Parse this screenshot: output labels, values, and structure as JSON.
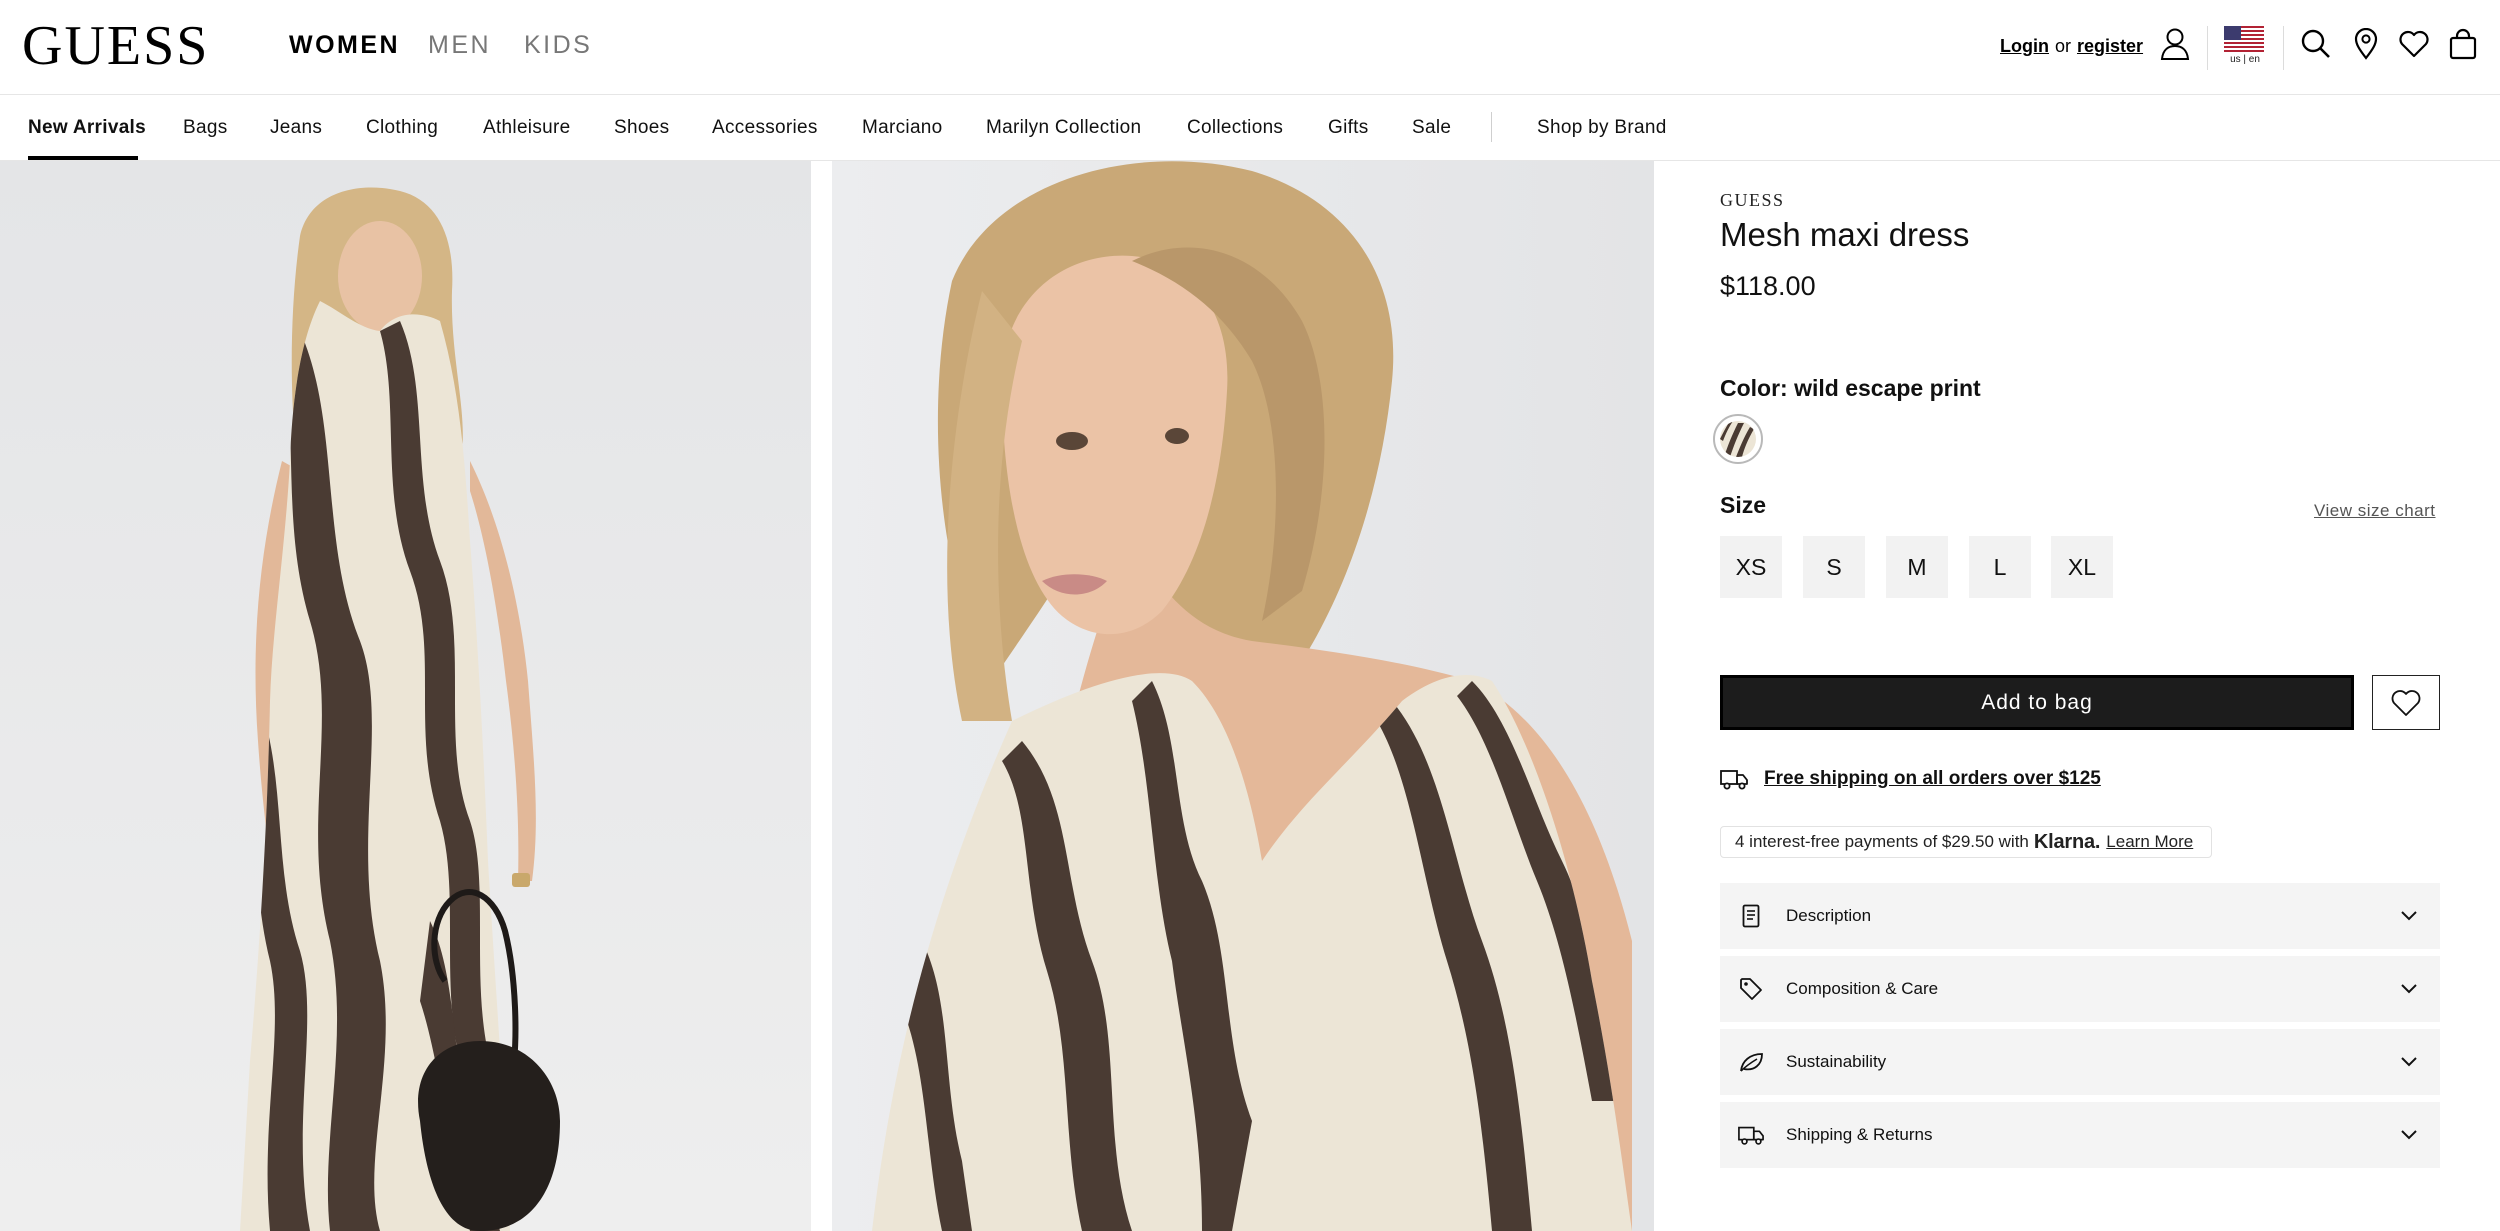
{
  "header": {
    "logo": "GUESS",
    "gender_tabs": [
      {
        "label": "WOMEN",
        "active": true
      },
      {
        "label": "MEN",
        "active": false
      },
      {
        "label": "KIDS",
        "active": false
      }
    ],
    "login_label": "Login",
    "or_label": "or",
    "register_label": "register",
    "locale_label": "us | en",
    "icons": [
      "account-icon",
      "us-flag-icon",
      "search-icon",
      "store-locator-icon",
      "wishlist-icon",
      "shopping-bag-icon"
    ]
  },
  "category_nav": {
    "items": [
      {
        "label": "New Arrivals",
        "active": true
      },
      {
        "label": "Bags"
      },
      {
        "label": "Jeans"
      },
      {
        "label": "Clothing"
      },
      {
        "label": "Athleisure"
      },
      {
        "label": "Shoes"
      },
      {
        "label": "Accessories"
      },
      {
        "label": "Marciano"
      },
      {
        "label": "Marilyn Collection"
      },
      {
        "label": "Collections"
      },
      {
        "label": "Gifts"
      },
      {
        "label": "Sale"
      },
      {
        "label": "Shop by Brand"
      }
    ]
  },
  "product": {
    "brand": "GUESS",
    "title": "Mesh maxi dress",
    "price": "$118.00",
    "color_label": "Color: wild escape print",
    "size_label": "Size",
    "size_chart_link": "View size chart",
    "sizes": [
      "XS",
      "S",
      "M",
      "L",
      "XL"
    ],
    "add_to_bag": "Add to bag",
    "shipping_text": "Free shipping on all orders over $125",
    "klarna": {
      "text": "4 interest-free payments of $29.50 with",
      "logo": "Klarna.",
      "learn_more": "Learn More"
    },
    "accordions": [
      {
        "label": "Description",
        "icon": "document-icon"
      },
      {
        "label": "Composition & Care",
        "icon": "tag-icon"
      },
      {
        "label": "Sustainability",
        "icon": "leaf-icon"
      },
      {
        "label": "Shipping & Returns",
        "icon": "truck-icon"
      }
    ]
  },
  "colors": {
    "primary": "#000000",
    "button_bg": "#1c1c1c",
    "size_bg": "#f2f2f2",
    "accordion_bg": "#f4f4f4",
    "print_dark": "#4a3b33",
    "print_light": "#ece5d6"
  }
}
